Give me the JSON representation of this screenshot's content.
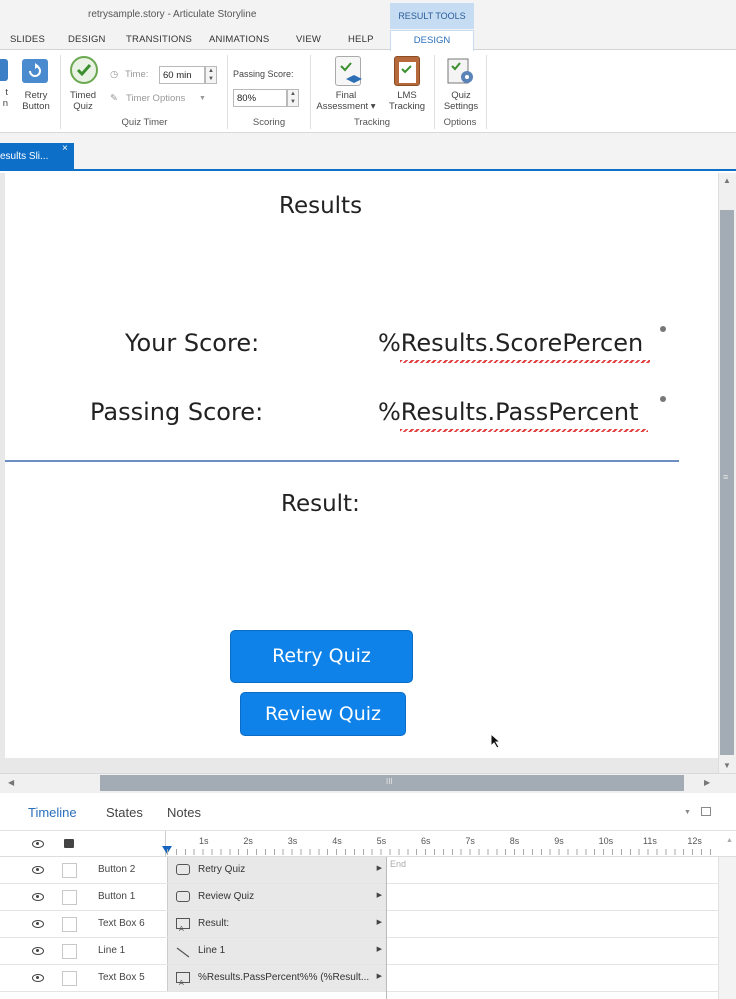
{
  "window": {
    "title": "retrysample.story - Articulate Storyline",
    "context_header": "RESULT TOOLS"
  },
  "ribbon_tabs": [
    "SLIDES",
    "DESIGN",
    "TRANSITIONS",
    "ANIMATIONS",
    "VIEW",
    "HELP"
  ],
  "context_tab": "DESIGN",
  "ribbon": {
    "partial_button_label": "t\nn",
    "retry_button": "Retry\nButton",
    "timed_quiz": "Timed\nQuiz",
    "time_label": "Time:",
    "time_value": "60 min",
    "timer_options": "Timer Options",
    "quiz_timer_group": "Quiz Timer",
    "passing_score_label": "Passing Score:",
    "passing_score_value": "80%",
    "scoring_group": "Scoring",
    "final_assessment": "Final\nAssessment",
    "lms_tracking": "LMS\nTracking",
    "tracking_group": "Tracking",
    "quiz_settings": "Quiz\nSettings",
    "options_group": "Options"
  },
  "doc_tab": {
    "label": "esults Sli...",
    "close": "×"
  },
  "slide": {
    "title": "Results",
    "your_score_label": "Your Score:",
    "your_score_value": "%Results.ScorePercen",
    "passing_score_label": "Passing Score:",
    "passing_score_value": "%Results.PassPercent",
    "result_label": "Result:",
    "retry_button": "Retry Quiz",
    "review_button": "Review Quiz"
  },
  "scrollbar": {
    "h_grip": "III",
    "v_grip": "≡"
  },
  "panel_tabs": [
    "Timeline",
    "States",
    "Notes"
  ],
  "timeline": {
    "ticks": [
      "1s",
      "2s",
      "3s",
      "4s",
      "5s",
      "6s",
      "7s",
      "8s",
      "9s",
      "10s",
      "11s",
      "12s"
    ],
    "end_label": "End",
    "rows": [
      {
        "name": "Button 2",
        "bar": "Retry Quiz",
        "icon": "button-icon"
      },
      {
        "name": "Button 1",
        "bar": "Review Quiz",
        "icon": "button-icon"
      },
      {
        "name": "Text Box 6",
        "bar": "Result:",
        "icon": "textbox-icon"
      },
      {
        "name": "Line 1",
        "bar": "Line 1",
        "icon": "line-icon"
      },
      {
        "name": "Text Box 5",
        "bar": "%Results.PassPercent%% (%Result...",
        "icon": "textbox-icon"
      }
    ]
  },
  "colors": {
    "accent": "#0e6fc9",
    "quiz_button": "#0e82e8",
    "context_tab": "#c6dcf2"
  }
}
